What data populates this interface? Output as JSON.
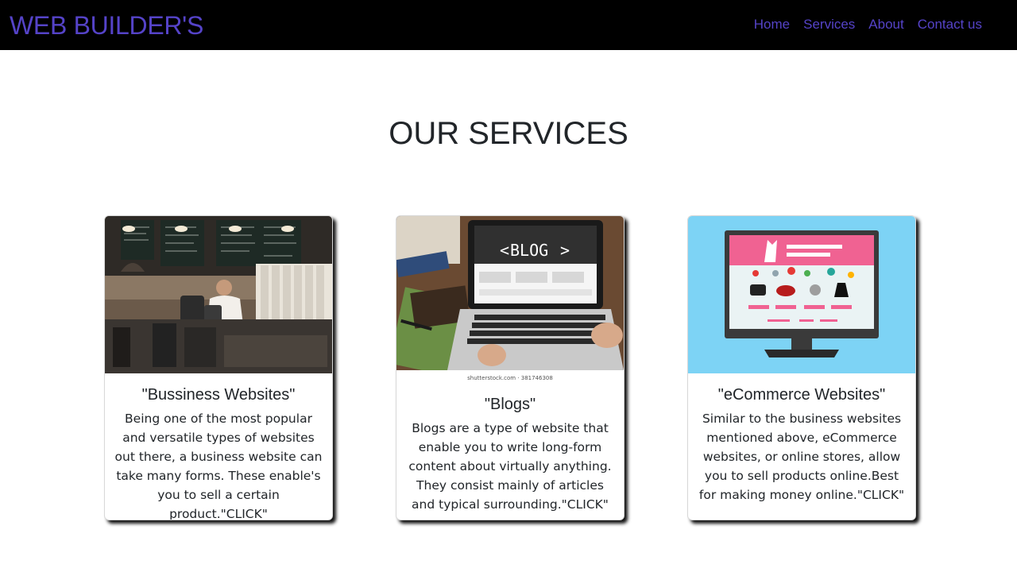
{
  "navbar": {
    "brand": "WEB BUILDER'S",
    "links": [
      "Home",
      "Services",
      "About",
      "Contact us"
    ]
  },
  "section": {
    "title": "OUR SERVICES"
  },
  "cards": [
    {
      "image": "coffee-shop-image",
      "title": "\"Bussiness Websites\"",
      "text": "Being one of the most popular and versatile types of websites out there, a business website can take many forms. These enable's you to sell a certain product.\"CLICK\""
    },
    {
      "image": "laptop-blog-image",
      "image_caption": "shutterstock.com · 381746308",
      "title": "\"Blogs\"",
      "text": "Blogs are a type of website that enable you to write long-form content about virtually anything. They consist mainly of articles and typical surrounding.\"CLICK\""
    },
    {
      "image": "ecommerce-monitor-image",
      "title": "\"eCommerce Websites\"",
      "text": "Similar to the business websites mentioned above, eCommerce websites, or online stores, allow you to sell products online.Best for making money online.\"CLICK\""
    }
  ],
  "colors": {
    "navbar_bg": "#000000",
    "brand": "#5543c8",
    "ecommerce_bg": "#7dd3f5",
    "ecommerce_accent": "#f06292"
  }
}
